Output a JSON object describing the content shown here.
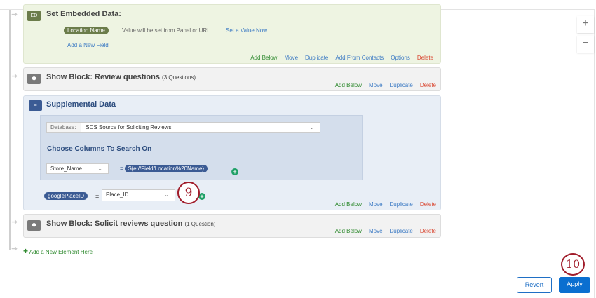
{
  "embedded": {
    "title": "Set Embedded Data:",
    "icon_label": "ED",
    "field": "Location Name",
    "field_desc": "Value will be set from Panel or URL.",
    "set_value": "Set a Value Now",
    "add_field": "Add a New Field",
    "actions": [
      "Add Below",
      "Move",
      "Duplicate",
      "Add From Contacts",
      "Options",
      "Delete"
    ]
  },
  "review": {
    "title": "Show Block: Review questions",
    "count": "(3 Questions)",
    "actions": [
      "Add Below",
      "Move",
      "Duplicate",
      "Delete"
    ]
  },
  "supplemental": {
    "title": "Supplemental Data",
    "db_label": "Database:",
    "db_value": "SDS Source for Soliciting Reviews",
    "columns_heading": "Choose Columns To Search On",
    "column": "Store_Name",
    "equals": "=",
    "piped": "${e://Field/Location%20Name}",
    "var": "googlePlaceID",
    "var_equals": "=",
    "var_value": "Place_ID",
    "actions": [
      "Add Below",
      "Move",
      "Duplicate",
      "Delete"
    ]
  },
  "solicit": {
    "title": "Show Block: Solicit reviews question",
    "count": "(1 Question)",
    "actions": [
      "Add Below",
      "Move",
      "Duplicate",
      "Delete"
    ]
  },
  "add_element": "Add a New Element Here",
  "callouts": {
    "nine": "9",
    "ten": "10"
  },
  "footer": {
    "revert": "Revert",
    "apply": "Apply"
  },
  "zoom": {
    "in": "+",
    "out": "−"
  }
}
